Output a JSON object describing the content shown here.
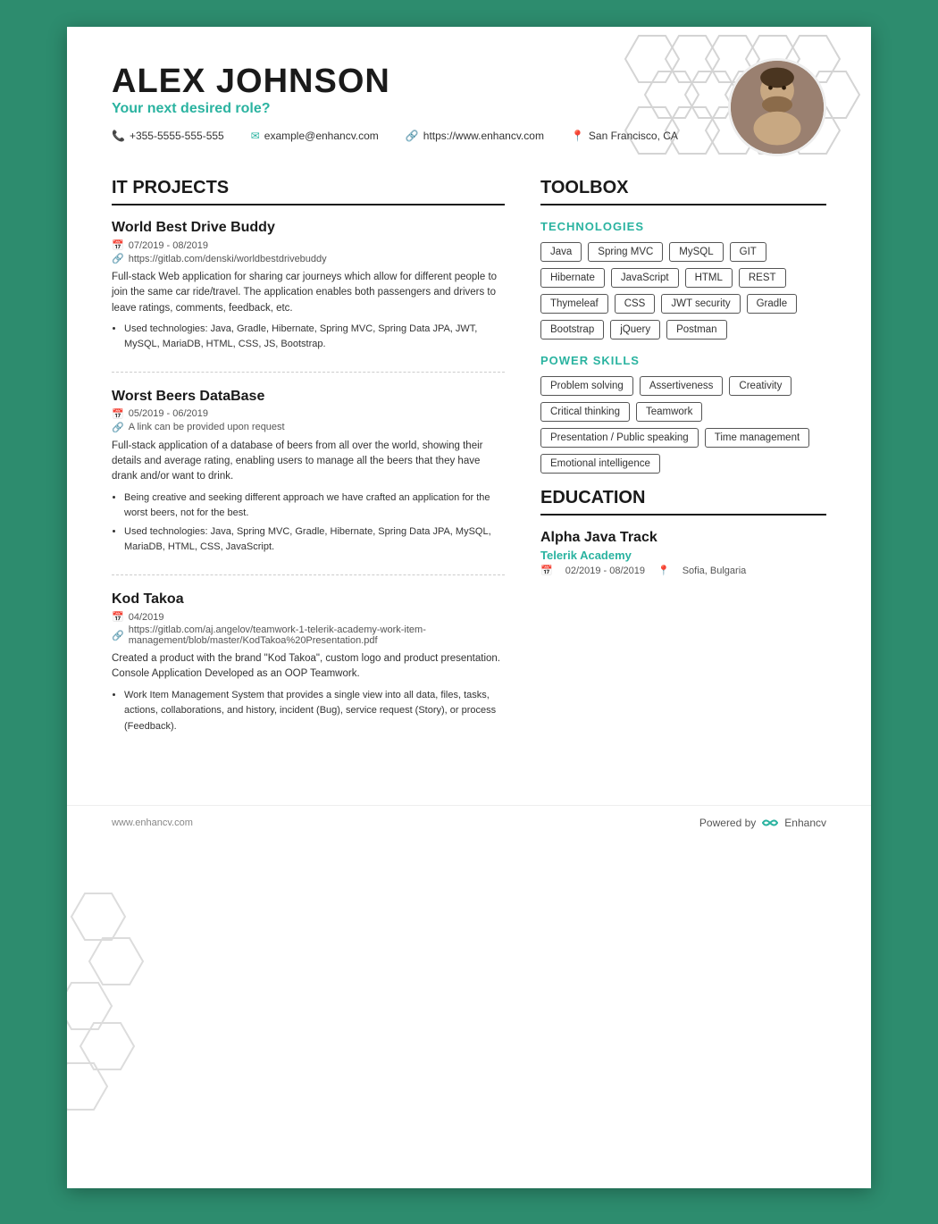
{
  "header": {
    "name": "ALEX JOHNSON",
    "role": "Your next desired role?",
    "phone": "+355-5555-555-555",
    "website": "https://www.enhancv.com",
    "email": "example@enhancv.com",
    "location": "San Francisco, CA"
  },
  "sections": {
    "it_projects": {
      "title": "IT PROJECTS",
      "projects": [
        {
          "title": "World Best Drive Buddy",
          "date": "07/2019 - 08/2019",
          "link": "https://gitlab.com/denski/worldbestdrivebuddy",
          "description": "Full-stack Web application for sharing car journeys which allow for different people to join the same car ride/travel. The application enables both passengers and drivers to leave ratings, comments, feedback, etc.",
          "bullets": [
            "Used technologies: Java, Gradle, Hibernate, Spring MVC, Spring Data JPA, JWT, MySQL, MariaDB, HTML, CSS, JS, Bootstrap."
          ]
        },
        {
          "title": "Worst Beers DataBase",
          "date": "05/2019 - 06/2019",
          "link": "A link can be provided upon request",
          "description": "Full-stack application of a database of beers from all over the world, showing their details and average rating, enabling users to manage all the beers that they have drank and/or want to drink.",
          "bullets": [
            "Being creative and seeking different approach we have crafted an application for the worst beers, not for the best.",
            "Used technologies: Java, Spring MVC, Gradle, Hibernate, Spring Data JPA, MySQL, MariaDB, HTML, CSS, JavaScript."
          ]
        },
        {
          "title": "Kod Takoa",
          "date": "04/2019",
          "link": "https://gitlab.com/aj.angelov/teamwork-1-telerik-academy-work-item-management/blob/master/KodTakoa%20Presentation.pdf",
          "description": "Created a product with the brand \"Kod Takoa\", custom logo and product presentation. Console Application Developed as an OOP Teamwork.",
          "bullets": [
            "Work Item Management System that provides a single view into all data, files, tasks, actions, collaborations, and history, incident (Bug), service request (Story), or process (Feedback)."
          ]
        }
      ]
    },
    "toolbox": {
      "title": "TOOLBOX",
      "technologies": {
        "subtitle": "TECHNOLOGIES",
        "tags": [
          "Java",
          "Spring MVC",
          "MySQL",
          "GIT",
          "Hibernate",
          "JavaScript",
          "HTML",
          "REST",
          "Thymeleaf",
          "CSS",
          "JWT security",
          "Gradle",
          "Bootstrap",
          "jQuery",
          "Postman"
        ]
      },
      "power_skills": {
        "subtitle": "POWER SKILLS",
        "tags": [
          "Problem solving",
          "Assertiveness",
          "Creativity",
          "Critical thinking",
          "Teamwork",
          "Presentation / Public speaking",
          "Time management",
          "Emotional intelligence"
        ]
      }
    },
    "education": {
      "title": "EDUCATION",
      "items": [
        {
          "degree": "Alpha Java Track",
          "institution": "Telerik Academy",
          "date": "02/2019 - 08/2019",
          "location": "Sofia, Bulgaria"
        }
      ]
    }
  },
  "footer": {
    "website": "www.enhancv.com",
    "powered_by": "Powered by",
    "brand": "Enhancv"
  }
}
